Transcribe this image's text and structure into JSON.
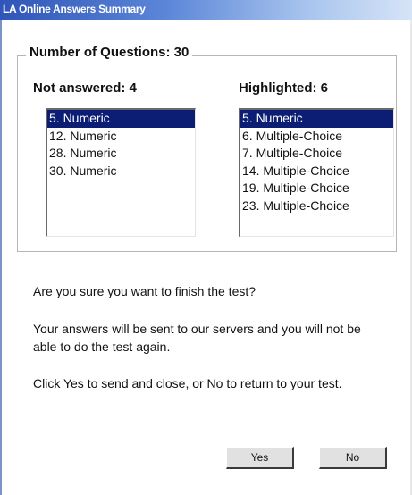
{
  "window": {
    "title": "LA Online Answers Summary"
  },
  "summary": {
    "group_title": "Number of Questions: 30",
    "not_answered": {
      "heading": "Not answered: 4",
      "items": [
        "5. Numeric",
        "12. Numeric",
        "28. Numeric",
        "30. Numeric"
      ],
      "selected_item": "5. Numeric"
    },
    "highlighted": {
      "heading": "Highlighted: 6",
      "items": [
        "5. Numeric",
        "6. Multiple-Choice",
        "7. Multiple-Choice",
        "14. Multiple-Choice",
        "19. Multiple-Choice",
        "23. Multiple-Choice"
      ],
      "selected_item": "5. Numeric"
    }
  },
  "message": {
    "question": "Are you sure you want to finish the test?",
    "warning": "Your answers will be sent to our servers and you will not be able to do the test again.",
    "instruction": "Click Yes to send and close, or No to return to your test."
  },
  "buttons": {
    "yes_label": "Yes",
    "no_label": "No"
  },
  "colors": {
    "selection": "#0b1e74",
    "titlebar": "#2f55b8"
  }
}
